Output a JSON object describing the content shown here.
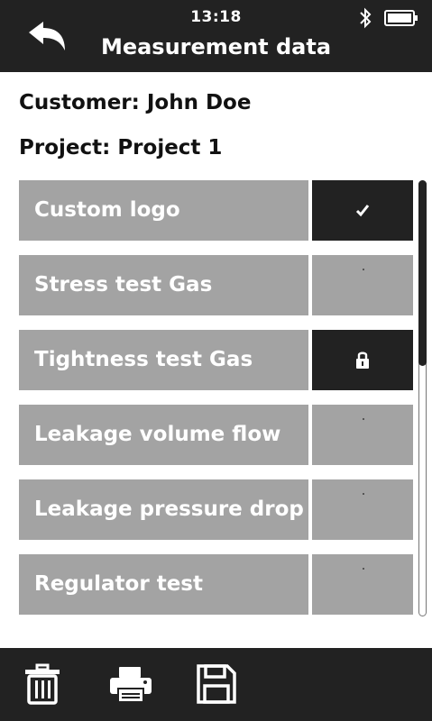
{
  "status_bar": {
    "time": "13:18",
    "bluetooth_icon": "bluetooth-icon",
    "battery_icon": "battery-icon"
  },
  "header": {
    "title": "Measurement data",
    "back_icon": "back-arrow-icon"
  },
  "info": {
    "customer": "Customer: John Doe",
    "project": "Project: Project 1"
  },
  "rows": [
    {
      "label": "Custom logo",
      "status": "checked",
      "status_icon": "checkmark-icon"
    },
    {
      "label": "Stress test Gas",
      "status": "none"
    },
    {
      "label": "Tightness test Gas",
      "status": "locked",
      "status_icon": "lock-icon"
    },
    {
      "label": "Leakage volume flow",
      "status": "none"
    },
    {
      "label": "Leakage pressure drop",
      "status": "none"
    },
    {
      "label": "Regulator test",
      "status": "none"
    }
  ],
  "footer": {
    "icons": [
      "trash-icon",
      "printer-icon",
      "save-icon"
    ]
  },
  "colors": {
    "bar": "#222222",
    "row": "#a3a3a3",
    "active": "#222222"
  }
}
